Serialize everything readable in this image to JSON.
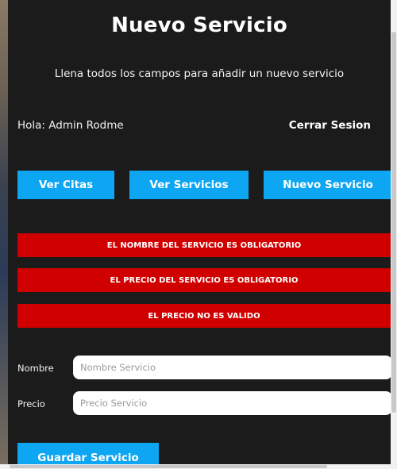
{
  "page": {
    "title": "Nuevo Servicio",
    "subtitle": "Llena todos los campos para añadir un nuevo servicio"
  },
  "header": {
    "greeting": "Hola: Admin Rodme",
    "logout_label": "Cerrar Sesion"
  },
  "nav": {
    "items": [
      {
        "label": "Ver Citas"
      },
      {
        "label": "Ver Servicios"
      },
      {
        "label": "Nuevo Servicio"
      }
    ]
  },
  "alerts": [
    {
      "message": "EL NOMBRE DEL SERVICIO ES OBLIGATORIO"
    },
    {
      "message": "EL PRECIO DEL SERVICIO ES OBLIGATORIO"
    },
    {
      "message": "EL PRECIO NO ES VALIDO"
    }
  ],
  "form": {
    "name_label": "Nombre",
    "name_value": "",
    "name_placeholder": "Nombre Servicio",
    "price_label": "Precio",
    "price_value": "",
    "price_placeholder": "Precio Servicio",
    "submit_label": "Guardar Servicio"
  },
  "colors": {
    "background": "#1b1b1b",
    "accent": "#0da6f2",
    "error": "#d10000"
  }
}
